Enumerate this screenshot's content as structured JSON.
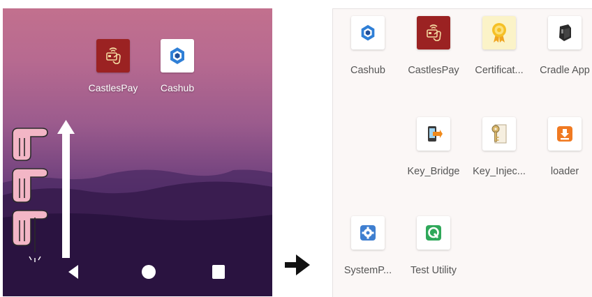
{
  "left_screen": {
    "apps": [
      {
        "label": "CastlesPay",
        "icon": "castlespay-icon",
        "color": "#9b2222"
      },
      {
        "label": "Cashub",
        "icon": "cashub-icon",
        "color": "#ffffff"
      }
    ],
    "gesture": "swipe-up",
    "navbar": {
      "back": "back-icon",
      "home": "home-icon",
      "recents": "recents-icon"
    }
  },
  "transition_arrow": "arrow-right-icon",
  "app_drawer": {
    "apps": [
      {
        "label": "Cashub",
        "icon": "cashub-icon"
      },
      {
        "label": "CastlesPay",
        "icon": "castlespay-icon"
      },
      {
        "label": "Certificat...",
        "icon": "certificate-icon"
      },
      {
        "label": "Cradle App",
        "icon": "cradle-icon"
      },
      {
        "label": "Key_Bridge",
        "icon": "key-bridge-icon"
      },
      {
        "label": "Key_Injec...",
        "icon": "key-injector-icon"
      },
      {
        "label": "loader",
        "icon": "loader-icon"
      },
      {
        "label": "SystemP...",
        "icon": "settings-icon"
      },
      {
        "label": "Test Utility",
        "icon": "test-utility-icon"
      }
    ]
  }
}
